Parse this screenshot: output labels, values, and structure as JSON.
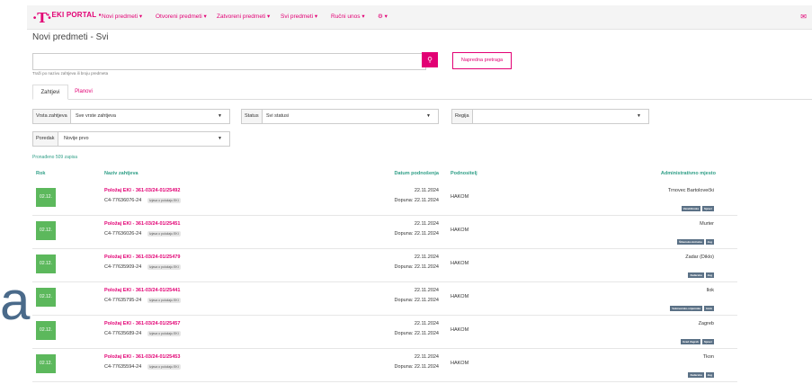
{
  "nav": {
    "logo": "·T·",
    "brand": "▪ EKI PORTAL ▪",
    "menu": [
      {
        "label": "Novi predmeti ▾"
      },
      {
        "label": "Otvoreni predmeti ▾"
      },
      {
        "label": "Zatvoreni predmeti ▾"
      },
      {
        "label": "Svi predmeti ▾"
      },
      {
        "label": "Ručni unos ▾"
      },
      {
        "label": "⚙ ▾"
      }
    ],
    "mail_icon": "✉",
    "accent": "#e20074"
  },
  "page": {
    "title": "Novi predmeti - Svi"
  },
  "search": {
    "placeholder": "",
    "button_icon": "🔍",
    "advanced_label": "Napredna pretraga",
    "hint": "Traži po nazivu zahtjeva ili broju predmeta"
  },
  "tabs": [
    {
      "label": "Zahtjevi"
    },
    {
      "label": "Planovi"
    }
  ],
  "filters": {
    "vrsta": {
      "label": "Vrsta zahtjeva",
      "value": "Sve vrste zahtjeva"
    },
    "status": {
      "label": "Status",
      "value": "Svi statusi"
    },
    "regija": {
      "label": "Regija",
      "value": ""
    },
    "poredak": {
      "label": "Poredak",
      "value": "Novije prvo"
    }
  },
  "results": {
    "found": "Pronađeno 509 zapisa"
  },
  "table": {
    "headers": {
      "rok": "Rok",
      "naziv": "Naziv zahtjeva",
      "datum": "Datum podnošenja",
      "podnositelj": "Podnositelj",
      "mjesto": "Administrativno mjesto"
    },
    "rows": [
      {
        "rok": "02.12.",
        "naziv": "Položaj EKI - 361-03/24-01/25492",
        "code": "C4-77636076-24",
        "tag": "Izjava o položaju EKI",
        "date": "22.11.2024",
        "dopuna": "Dopuna: 22.11.2024",
        "podnositelj": "HAKOM",
        "place": "Trnovec Bartolovečki",
        "badges": [
          "Varaždinska",
          "Sjever"
        ]
      },
      {
        "rok": "02.12.",
        "naziv": "Položaj EKI - 361-03/24-01/25451",
        "code": "C4-77636026-24",
        "tag": "Izjava o položaju EKI",
        "date": "22.11.2024",
        "dopuna": "Dopuna: 22.11.2024",
        "podnositelj": "HAKOM",
        "place": "Murter",
        "badges": [
          "Šibensko-kninska",
          "Jug"
        ]
      },
      {
        "rok": "02.12.",
        "naziv": "Položaj EKI - 361-03/24-01/25479",
        "code": "C4-77635909-24",
        "tag": "Izjava o položaju EKI",
        "date": "22.11.2024",
        "dopuna": "Dopuna: 22.11.2024",
        "podnositelj": "HAKOM",
        "place": "Zadar (Diklo)",
        "badges": [
          "Zadarska",
          "Jug"
        ]
      },
      {
        "rok": "02.12.",
        "naziv": "Položaj EKI - 361-03/24-01/25441",
        "code": "C4-77635795-24",
        "tag": "Izjava o položaju EKI",
        "date": "22.11.2024",
        "dopuna": "Dopuna: 22.11.2024",
        "podnositelj": "HAKOM",
        "place": "Ilok",
        "badges": [
          "Vukovarsko-srijemska",
          "Istok"
        ]
      },
      {
        "rok": "02.12.",
        "naziv": "Položaj EKI - 361-03/24-01/25457",
        "code": "C4-77635689-24",
        "tag": "Izjava o položaju EKI",
        "date": "22.11.2024",
        "dopuna": "Dopuna: 22.11.2024",
        "podnositelj": "HAKOM",
        "place": "Zagreb",
        "badges": [
          "Grad Zagreb",
          "Sjever"
        ]
      },
      {
        "rok": "02.12.",
        "naziv": "Položaj EKI - 361-03/24-01/25453",
        "code": "C4-77635594-24",
        "tag": "Izjava o položaju EKI",
        "date": "22.11.2024",
        "dopuna": "Dopuna: 22.11.2024",
        "podnositelj": "HAKOM",
        "place": "Tkon",
        "badges": [
          "Zadarska",
          "Jug"
        ]
      }
    ]
  },
  "overlay": {
    "letter": "a"
  }
}
